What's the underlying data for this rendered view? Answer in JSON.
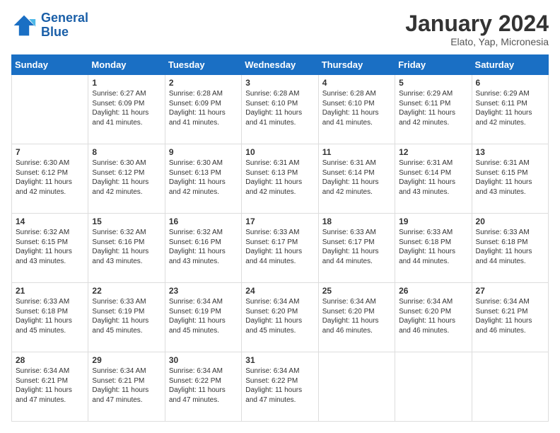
{
  "logo": {
    "line1": "General",
    "line2": "Blue"
  },
  "header": {
    "title": "January 2024",
    "location": "Elato, Yap, Micronesia"
  },
  "weekdays": [
    "Sunday",
    "Monday",
    "Tuesday",
    "Wednesday",
    "Thursday",
    "Friday",
    "Saturday"
  ],
  "weeks": [
    [
      {
        "day": "",
        "info": ""
      },
      {
        "day": "1",
        "info": "Sunrise: 6:27 AM\nSunset: 6:09 PM\nDaylight: 11 hours\nand 41 minutes."
      },
      {
        "day": "2",
        "info": "Sunrise: 6:28 AM\nSunset: 6:09 PM\nDaylight: 11 hours\nand 41 minutes."
      },
      {
        "day": "3",
        "info": "Sunrise: 6:28 AM\nSunset: 6:10 PM\nDaylight: 11 hours\nand 41 minutes."
      },
      {
        "day": "4",
        "info": "Sunrise: 6:28 AM\nSunset: 6:10 PM\nDaylight: 11 hours\nand 41 minutes."
      },
      {
        "day": "5",
        "info": "Sunrise: 6:29 AM\nSunset: 6:11 PM\nDaylight: 11 hours\nand 42 minutes."
      },
      {
        "day": "6",
        "info": "Sunrise: 6:29 AM\nSunset: 6:11 PM\nDaylight: 11 hours\nand 42 minutes."
      }
    ],
    [
      {
        "day": "7",
        "info": "Sunrise: 6:30 AM\nSunset: 6:12 PM\nDaylight: 11 hours\nand 42 minutes."
      },
      {
        "day": "8",
        "info": "Sunrise: 6:30 AM\nSunset: 6:12 PM\nDaylight: 11 hours\nand 42 minutes."
      },
      {
        "day": "9",
        "info": "Sunrise: 6:30 AM\nSunset: 6:13 PM\nDaylight: 11 hours\nand 42 minutes."
      },
      {
        "day": "10",
        "info": "Sunrise: 6:31 AM\nSunset: 6:13 PM\nDaylight: 11 hours\nand 42 minutes."
      },
      {
        "day": "11",
        "info": "Sunrise: 6:31 AM\nSunset: 6:14 PM\nDaylight: 11 hours\nand 42 minutes."
      },
      {
        "day": "12",
        "info": "Sunrise: 6:31 AM\nSunset: 6:14 PM\nDaylight: 11 hours\nand 43 minutes."
      },
      {
        "day": "13",
        "info": "Sunrise: 6:31 AM\nSunset: 6:15 PM\nDaylight: 11 hours\nand 43 minutes."
      }
    ],
    [
      {
        "day": "14",
        "info": "Sunrise: 6:32 AM\nSunset: 6:15 PM\nDaylight: 11 hours\nand 43 minutes."
      },
      {
        "day": "15",
        "info": "Sunrise: 6:32 AM\nSunset: 6:16 PM\nDaylight: 11 hours\nand 43 minutes."
      },
      {
        "day": "16",
        "info": "Sunrise: 6:32 AM\nSunset: 6:16 PM\nDaylight: 11 hours\nand 43 minutes."
      },
      {
        "day": "17",
        "info": "Sunrise: 6:33 AM\nSunset: 6:17 PM\nDaylight: 11 hours\nand 44 minutes."
      },
      {
        "day": "18",
        "info": "Sunrise: 6:33 AM\nSunset: 6:17 PM\nDaylight: 11 hours\nand 44 minutes."
      },
      {
        "day": "19",
        "info": "Sunrise: 6:33 AM\nSunset: 6:18 PM\nDaylight: 11 hours\nand 44 minutes."
      },
      {
        "day": "20",
        "info": "Sunrise: 6:33 AM\nSunset: 6:18 PM\nDaylight: 11 hours\nand 44 minutes."
      }
    ],
    [
      {
        "day": "21",
        "info": "Sunrise: 6:33 AM\nSunset: 6:18 PM\nDaylight: 11 hours\nand 45 minutes."
      },
      {
        "day": "22",
        "info": "Sunrise: 6:33 AM\nSunset: 6:19 PM\nDaylight: 11 hours\nand 45 minutes."
      },
      {
        "day": "23",
        "info": "Sunrise: 6:34 AM\nSunset: 6:19 PM\nDaylight: 11 hours\nand 45 minutes."
      },
      {
        "day": "24",
        "info": "Sunrise: 6:34 AM\nSunset: 6:20 PM\nDaylight: 11 hours\nand 45 minutes."
      },
      {
        "day": "25",
        "info": "Sunrise: 6:34 AM\nSunset: 6:20 PM\nDaylight: 11 hours\nand 46 minutes."
      },
      {
        "day": "26",
        "info": "Sunrise: 6:34 AM\nSunset: 6:20 PM\nDaylight: 11 hours\nand 46 minutes."
      },
      {
        "day": "27",
        "info": "Sunrise: 6:34 AM\nSunset: 6:21 PM\nDaylight: 11 hours\nand 46 minutes."
      }
    ],
    [
      {
        "day": "28",
        "info": "Sunrise: 6:34 AM\nSunset: 6:21 PM\nDaylight: 11 hours\nand 47 minutes."
      },
      {
        "day": "29",
        "info": "Sunrise: 6:34 AM\nSunset: 6:21 PM\nDaylight: 11 hours\nand 47 minutes."
      },
      {
        "day": "30",
        "info": "Sunrise: 6:34 AM\nSunset: 6:22 PM\nDaylight: 11 hours\nand 47 minutes."
      },
      {
        "day": "31",
        "info": "Sunrise: 6:34 AM\nSunset: 6:22 PM\nDaylight: 11 hours\nand 47 minutes."
      },
      {
        "day": "",
        "info": ""
      },
      {
        "day": "",
        "info": ""
      },
      {
        "day": "",
        "info": ""
      }
    ]
  ]
}
